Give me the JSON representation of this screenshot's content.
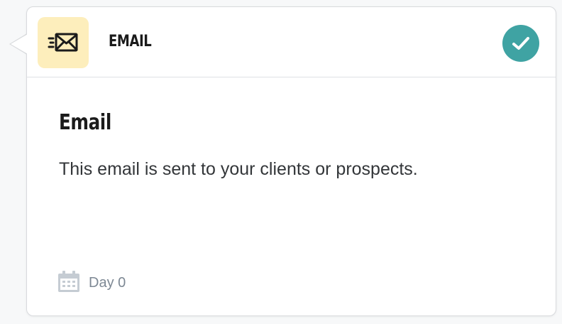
{
  "header": {
    "title": "EMAIL",
    "icon": "email-send-icon",
    "icon_bg_color": "#fdeebc",
    "status": "completed",
    "status_icon": "check-icon",
    "status_color": "#3fa3a3"
  },
  "content": {
    "title": "Email",
    "description": "This email is sent to your clients or prospects."
  },
  "footer": {
    "icon": "calendar-icon",
    "day_label": "Day 0"
  }
}
